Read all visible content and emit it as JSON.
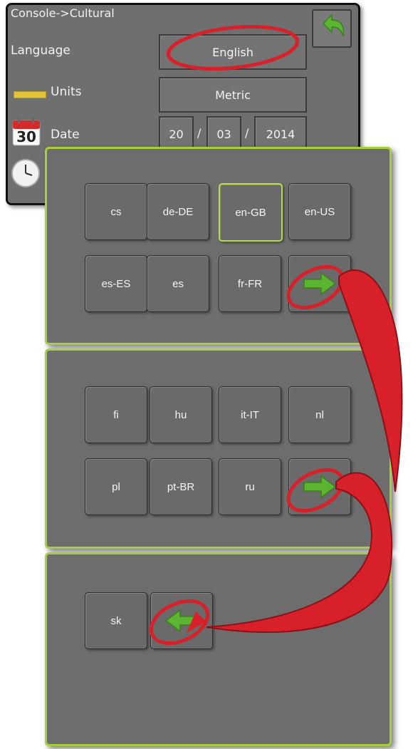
{
  "console": {
    "breadcrumb": "Console->Cultural",
    "rows": [
      {
        "label": "Language",
        "value": "English"
      },
      {
        "label": "Units",
        "value": "Metric"
      },
      {
        "label": "Date",
        "day": "20",
        "month": "03",
        "year": "2014",
        "separator": "/"
      }
    ],
    "calendar_day": "30"
  },
  "keypads": [
    {
      "keys": [
        "cs",
        "de-DE",
        "en-GB",
        "en-US",
        "es-ES",
        "es",
        "fr-FR"
      ],
      "selected": "en-GB",
      "nav": "next-arrow"
    },
    {
      "keys": [
        "fi",
        "hu",
        "it-IT",
        "nl",
        "pl",
        "pt-BR",
        "ru"
      ],
      "nav": "next-arrow"
    },
    {
      "keys": [
        "sk"
      ],
      "nav": "previous-arrow"
    }
  ],
  "colors": {
    "panel_border": "#a6d03b",
    "annotation": "#d8202a",
    "arrow_green": "#5cb531"
  }
}
